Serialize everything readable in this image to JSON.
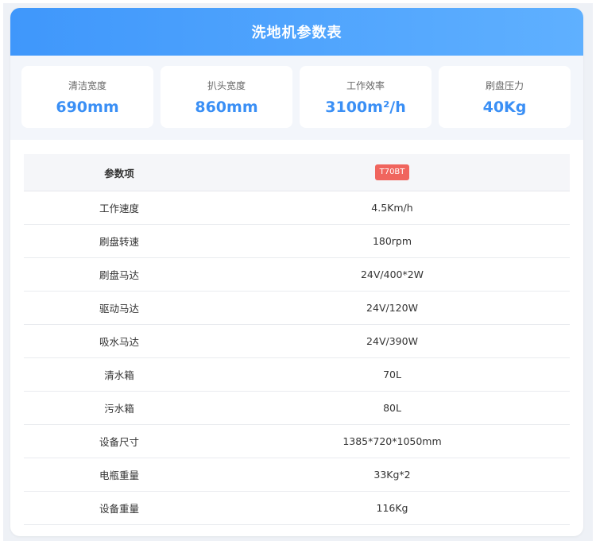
{
  "header": {
    "title": "洗地机参数表"
  },
  "stats": [
    {
      "label": "清洁宽度",
      "value": "690mm"
    },
    {
      "label": "扒头宽度",
      "value": "860mm"
    },
    {
      "label": "工作效率",
      "value": "3100m²/h"
    },
    {
      "label": "刷盘压力",
      "value": "40Kg"
    }
  ],
  "table": {
    "header": {
      "param": "参数项",
      "model": "T70BT"
    },
    "rows": [
      {
        "param": "工作速度",
        "value": "4.5Km/h"
      },
      {
        "param": "刷盘转速",
        "value": "180rpm"
      },
      {
        "param": "刷盘马达",
        "value": "24V/400*2W"
      },
      {
        "param": "驱动马达",
        "value": "24V/120W"
      },
      {
        "param": "吸水马达",
        "value": "24V/390W"
      },
      {
        "param": "清水箱",
        "value": "70L"
      },
      {
        "param": "污水箱",
        "value": "80L"
      },
      {
        "param": "设备尺寸",
        "value": "1385*720*1050mm"
      },
      {
        "param": "电瓶重量",
        "value": "33Kg*2"
      },
      {
        "param": "设备重量",
        "value": "116Kg"
      }
    ]
  },
  "colors": {
    "accent": "#3a8ff5",
    "badge": "#f0655e"
  }
}
